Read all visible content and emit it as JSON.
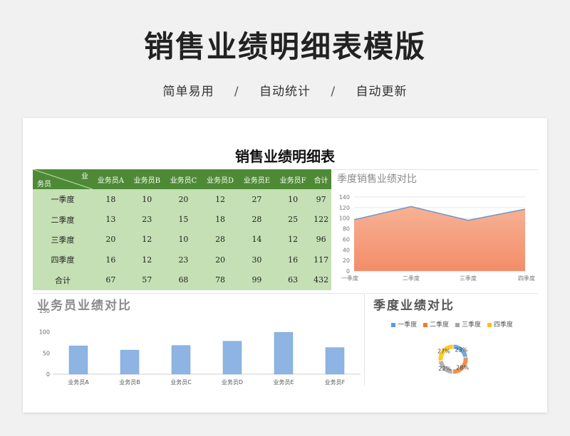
{
  "hero": {
    "title": "销售业绩明细表模版",
    "tag1": "简单易用",
    "tag2": "自动统计",
    "tag3": "自动更新",
    "sep": "/"
  },
  "sheet": {
    "title": "销售业绩明细表",
    "corner_top": "业",
    "corner_bottom": "务员",
    "headers": [
      "业务员A",
      "业务员B",
      "业务员C",
      "业务员D",
      "业务员E",
      "业务员F",
      "合计"
    ],
    "rows": [
      {
        "label": "一季度",
        "cells": [
          "18",
          "10",
          "20",
          "12",
          "27",
          "10",
          "97"
        ]
      },
      {
        "label": "二季度",
        "cells": [
          "13",
          "23",
          "15",
          "18",
          "28",
          "25",
          "122"
        ]
      },
      {
        "label": "三季度",
        "cells": [
          "20",
          "12",
          "10",
          "28",
          "14",
          "12",
          "96"
        ]
      },
      {
        "label": "四季度",
        "cells": [
          "16",
          "12",
          "23",
          "20",
          "30",
          "16",
          "117"
        ]
      },
      {
        "label": "合计",
        "cells": [
          "67",
          "57",
          "68",
          "78",
          "99",
          "63",
          "432"
        ]
      }
    ]
  },
  "colors": {
    "header_green": "#4e8a36",
    "cell_green": "#c5e0b4",
    "area_fill": "#f4a582",
    "area_line": "#6f96c8",
    "bar_blue": "#8db4e2",
    "q1": "#5b9bd5",
    "q2": "#ed7d31",
    "q3": "#a5a5a5",
    "q4": "#ffc000"
  },
  "chart_data": [
    {
      "type": "area",
      "title": "季度销售业绩对比",
      "categories": [
        "一季度",
        "二季度",
        "三季度",
        "四季度"
      ],
      "values": [
        97,
        122,
        96,
        117
      ],
      "ylim": [
        0,
        140
      ],
      "yticks": [
        0,
        20,
        40,
        60,
        80,
        100,
        120,
        140
      ],
      "grid": true
    },
    {
      "type": "bar",
      "title": "业务员业绩对比",
      "categories": [
        "业务员A",
        "业务员B",
        "业务员C",
        "业务员D",
        "业务员E",
        "业务员F"
      ],
      "values": [
        67,
        57,
        68,
        78,
        99,
        63
      ],
      "ylim": [
        0,
        150
      ],
      "yticks": [
        0,
        50,
        100,
        150
      ]
    },
    {
      "type": "pie",
      "title": "季度业绩对比",
      "categories": [
        "一季度",
        "二季度",
        "三季度",
        "四季度"
      ],
      "values": [
        97,
        122,
        96,
        117
      ],
      "labels": [
        "23%",
        "28%",
        "22%",
        "27%"
      ],
      "legend": "top"
    }
  ]
}
